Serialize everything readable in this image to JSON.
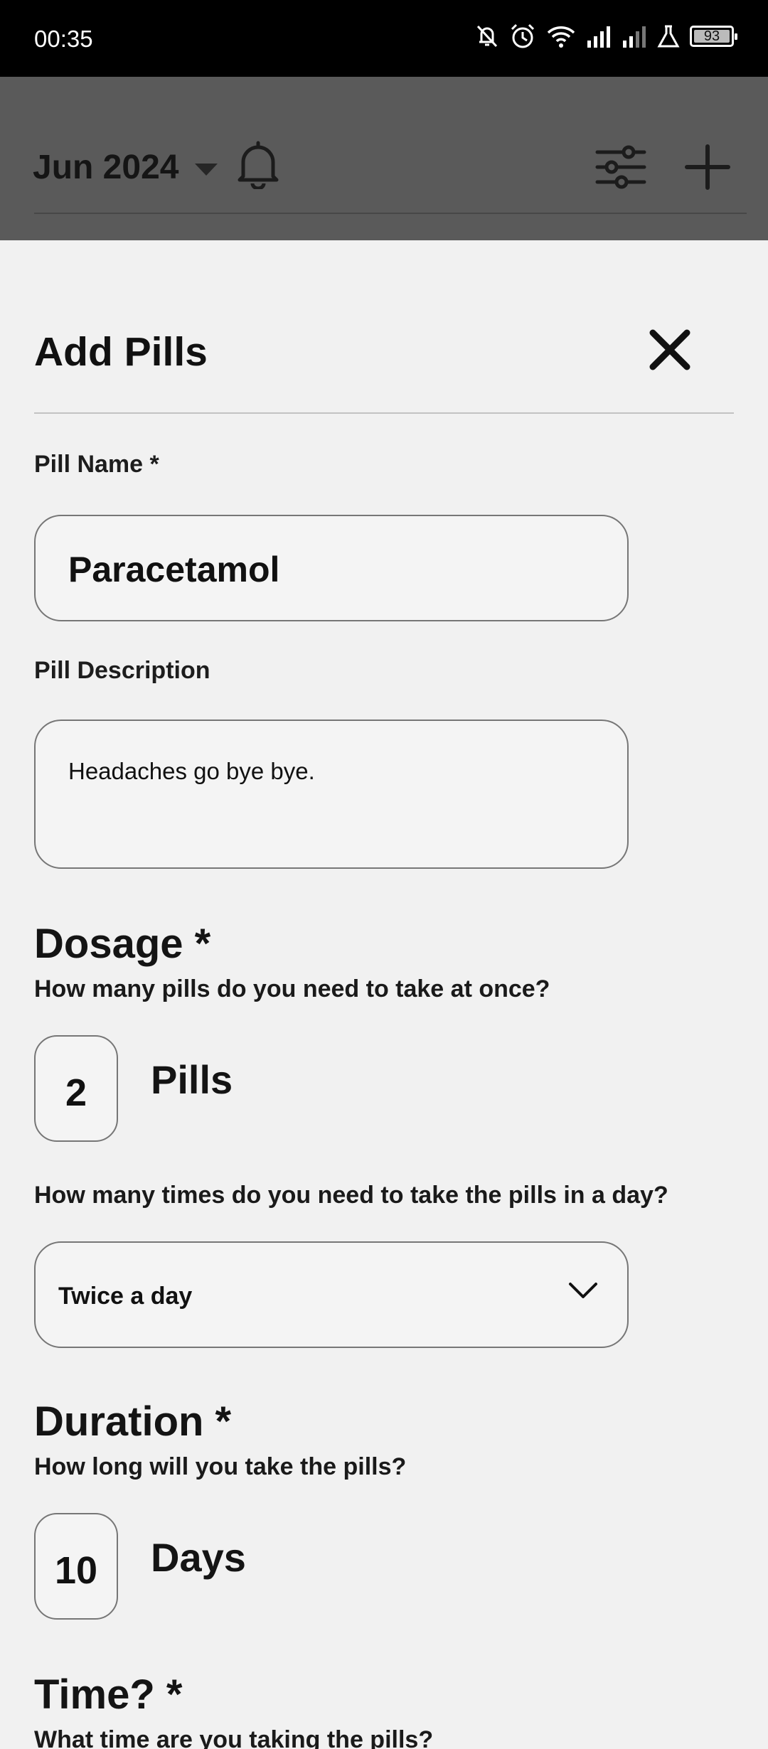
{
  "status_bar": {
    "time": "00:35",
    "battery": "93"
  },
  "app_bar": {
    "month": "Jun 2024"
  },
  "sheet": {
    "title": "Add Pills",
    "pill_name_label": "Pill Name *",
    "pill_name_value": "Paracetamol",
    "pill_description_label": "Pill Description",
    "pill_description_value": "Headaches go bye bye.",
    "dosage": {
      "heading": "Dosage *",
      "question": "How many pills do you need to take at once?",
      "value": "2",
      "unit": "Pills"
    },
    "frequency": {
      "question": "How many times do you need to take the pills in a day?",
      "selected": "Twice a day"
    },
    "duration": {
      "heading": "Duration *",
      "question": "How long will you take the pills?",
      "value": "10",
      "unit": "Days"
    },
    "time": {
      "heading": "Time? *",
      "question": "What time are you taking the pills?"
    }
  }
}
